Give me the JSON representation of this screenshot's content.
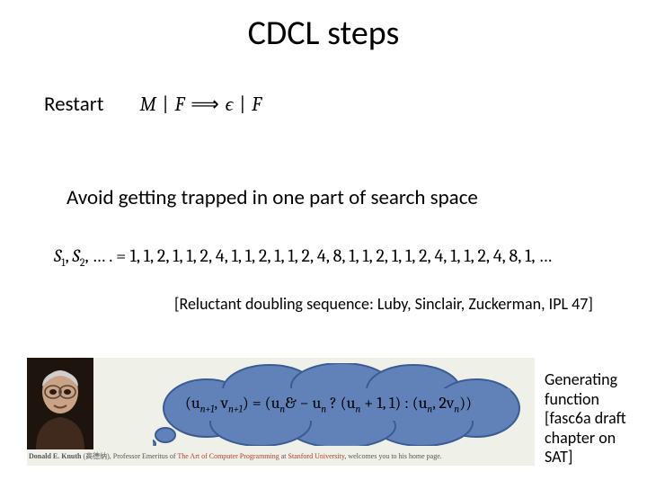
{
  "title": "CDCL steps",
  "restart": {
    "label": "Restart",
    "formula_html": "<span class='it'>M</span> | <span class='it'>F</span> &#x27F9; <span class='it'>&#x03F5;</span> | <span class='it'>F</span>"
  },
  "avoid_text": "Avoid getting trapped in one part of search space",
  "sequence": {
    "lhs_html": "<span class='it'>S</span><sub>1</sub>, <span class='it'>S</span><sub>2</sub>, &hellip; . =",
    "rhs": "1, 1, 2, 1, 1, 2, 4, 1, 1, 2, 1, 1, 2, 4, 8, 1, 1, 2, 1, 1, 2, 4, 1, 1, 2, 4, 8, 1, &hellip;"
  },
  "citation": "[Reluctant doubling sequence: Luby, Sinclair, Zuckerman, IPL 47]",
  "knuth_line_html": "<b>Donald E. Knuth</b> (高德纳), Professor Emeritus of <span class='red'>The Art of Computer Programming</span> at <span class='red'>Stanford University</span>, welcomes you to his home page.",
  "cloud_formula_html": "(<span class='it'>u</span><sub>n+1</sub>, <span class='it'>v</span><sub>n+1</sub>) = (<span class='it'>u</span><sub>n</sub>&amp; &minus; <span class='it'>u</span><sub>n</sub> ? (<span class='it'>u</span><sub>n</sub> + 1, 1) : (<span class='it'>u</span><sub>n</sub>, 2<span class='it'>v</span><sub>n</sub>))",
  "sidebox": "Generating function [fasc6a draft chapter on SAT]"
}
